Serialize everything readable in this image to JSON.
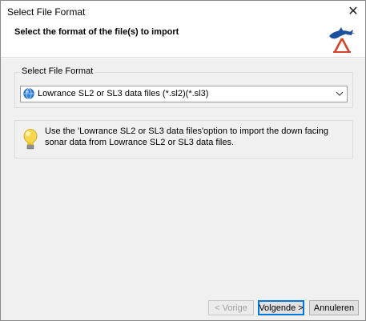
{
  "window": {
    "title": "Select File Format",
    "close_icon": "close-icon"
  },
  "header": {
    "heading": "Select the format of the file(s) to import",
    "logo_icon": "app-logo-icon",
    "brand_colors": {
      "blue": "#1c4f9c",
      "orange": "#d2452a"
    }
  },
  "format_group": {
    "legend": "Select File Format",
    "selected": "Lowrance SL2 or SL3 data files (*.sl2)(*.sl3)",
    "item_icon": "globe-icon",
    "dropdown_icon": "chevron-down-icon"
  },
  "info": {
    "icon": "lightbulb-icon",
    "text": "Use the 'Lowrance SL2 or SL3 data files'option to import the down facing sonar data from Lowrance SL2 or SL3 data files."
  },
  "buttons": {
    "previous": "< Vorige",
    "next": "Volgende >",
    "cancel": "Annuleren"
  }
}
